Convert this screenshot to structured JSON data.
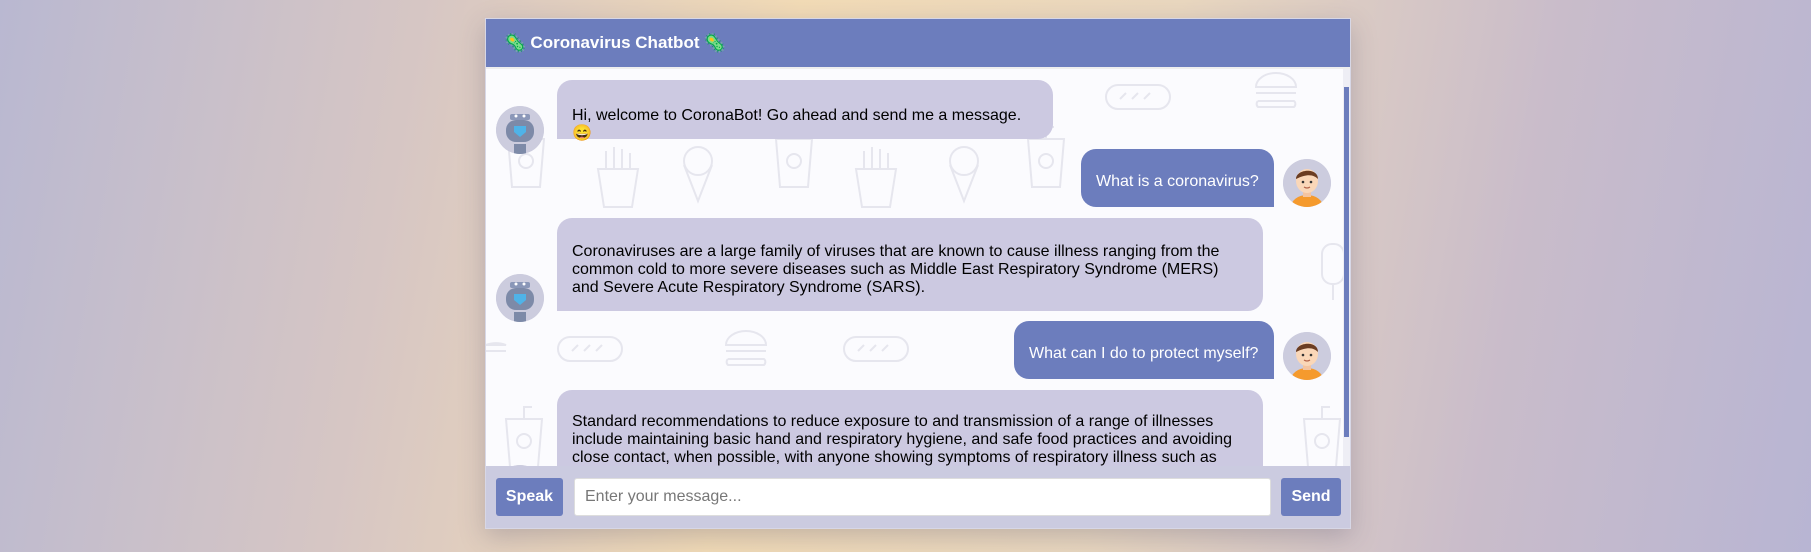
{
  "header": {
    "title": "Coronavirus Chatbot",
    "bug_left": "🦠",
    "bug_right": "🦠"
  },
  "messages": [
    {
      "sender": "bot",
      "text": "Hi, welcome to CoronaBot! Go ahead and send me a message. 😄"
    },
    {
      "sender": "user",
      "text": "What is a coronavirus?"
    },
    {
      "sender": "bot",
      "text": "Coronaviruses are a large family of viruses that are known to cause illness ranging from the common cold to more severe diseases such as Middle East Respiratory Syndrome (MERS) and Severe Acute Respiratory Syndrome (SARS)."
    },
    {
      "sender": "user",
      "text": "What can I do to protect myself?"
    },
    {
      "sender": "bot",
      "text": "Standard recommendations to reduce exposure to and transmission of a range of illnesses include maintaining basic hand and respiratory hygiene, and safe food practices and avoiding close contact, when possible, with anyone showing symptoms of respiratory illness such as"
    }
  ],
  "input": {
    "placeholder": "Enter your message..."
  },
  "buttons": {
    "speak": "Speak",
    "send": "Send"
  },
  "colors": {
    "accent": "#6c7dbd",
    "bot_bubble": "#ccc9e1",
    "input_bar": "#cbcbe0"
  },
  "icons": {
    "bot_avatar": "robot-avatar-icon",
    "user_avatar": "user-avatar-icon"
  }
}
